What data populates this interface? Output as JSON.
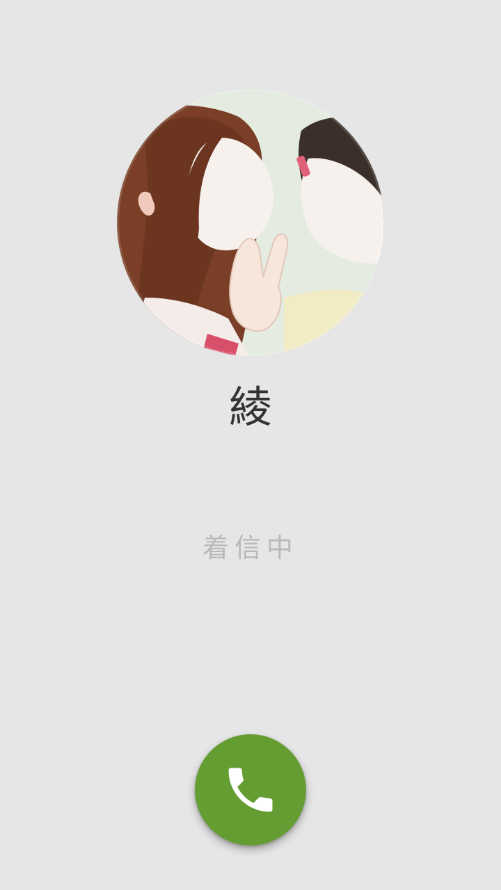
{
  "caller": {
    "name": "綾",
    "avatar": "contact-photo-watercolor-two-girls-peace-sign"
  },
  "call": {
    "status": "着信中"
  },
  "actions": {
    "answer_icon": "phone-icon",
    "answer_color": "#649d32"
  },
  "colors": {
    "background": "#e6e6e6",
    "name_text": "#333333",
    "status_text": "#b9b9b9"
  }
}
